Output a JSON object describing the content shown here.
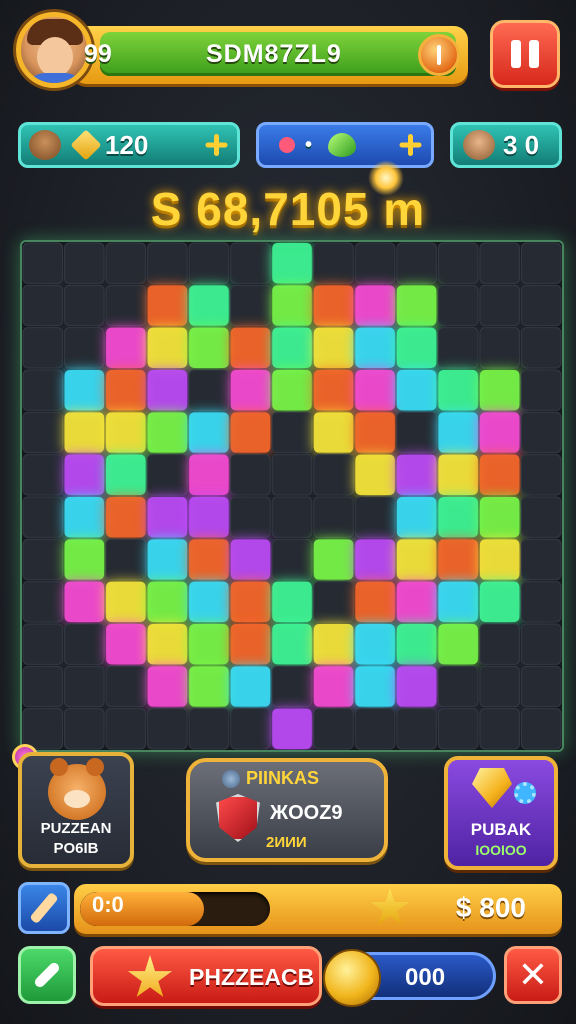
{
  "header": {
    "level": "99",
    "player_name": "SDM87ZL9",
    "avatar_icon": "player-avatar",
    "pause_icon": "pause-icon"
  },
  "stats": {
    "first": {
      "icon": "bear-icon",
      "sub_icon": "diamond-icon",
      "value": "120",
      "action_icon": "sparkle-icon"
    },
    "second": {
      "icon": "wand-icon",
      "value": "•",
      "gem_icon": "green-gem-icon",
      "action_icon": "sparkle-icon"
    },
    "third": {
      "icon": "face-icon",
      "value": "3 0"
    }
  },
  "score": "S 68,7105 m",
  "board": {
    "rows": 12,
    "cols": 13,
    "palette": [
      "#ff4ddb",
      "#ffef3a",
      "#7dff4a",
      "#3ae6ff",
      "#ff6a2a",
      "#c34dff",
      "#3fff9a"
    ]
  },
  "cards": {
    "left": {
      "title": "PUZZEAN",
      "subtitle": "PO6IB"
    },
    "middle": {
      "title": "PIINKAS",
      "code": "ЖOOZ9",
      "value": "2ИИИ"
    },
    "right": {
      "title": "PUBAK",
      "value": "IOOIOO"
    }
  },
  "progress": {
    "text": "0:0",
    "fraction": 0.65,
    "gold": "$ 800"
  },
  "bottom": {
    "cta_label": "PHZZEACB",
    "coins": "000",
    "close_label": "✕"
  },
  "colors": {
    "accent_gold": "#f0b33a",
    "accent_green": "#7fd33a",
    "accent_red": "#d6281b",
    "score_gold": "#ffd53a"
  }
}
